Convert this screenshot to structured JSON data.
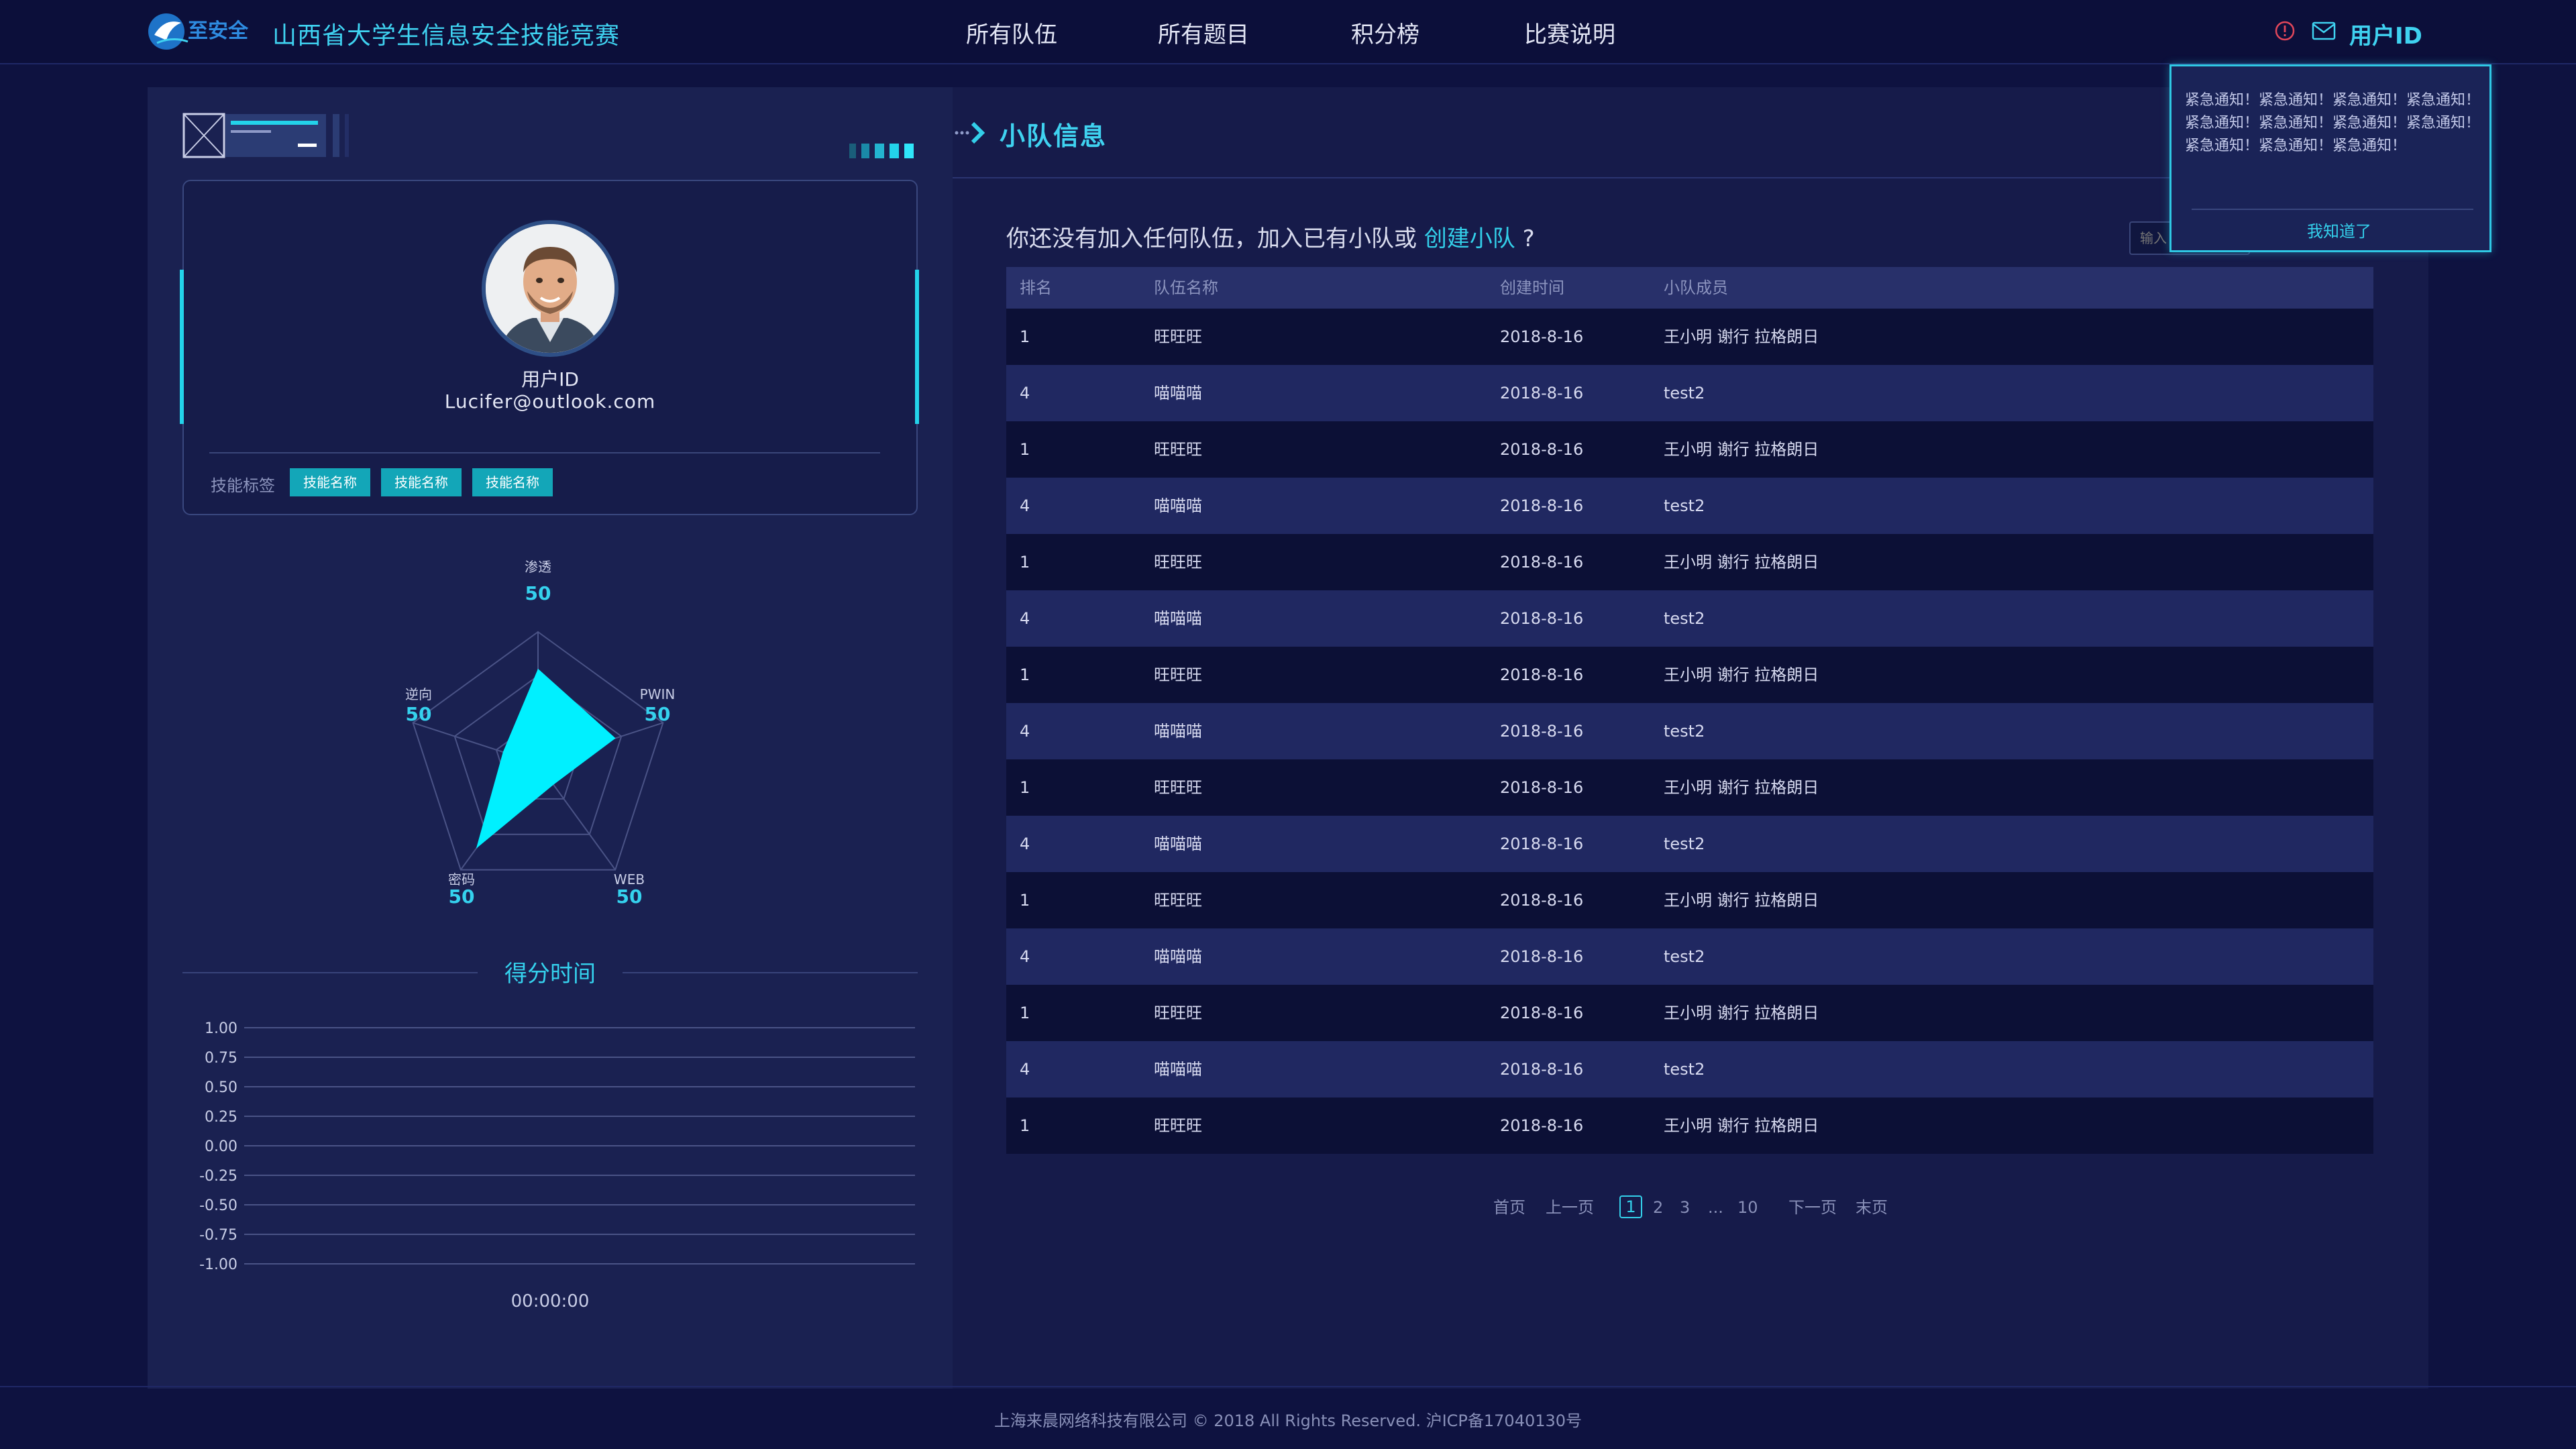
{
  "header": {
    "logo_text": "至安全",
    "site_title": "山西省大学生信息安全技能竞赛",
    "nav": [
      "所有队伍",
      "所有题目",
      "积分榜",
      "比赛说明"
    ],
    "user_label": "用户ID",
    "alert_icon": "alert-circle-icon",
    "mail_icon": "mail-icon"
  },
  "profile": {
    "user_id": "用户ID",
    "email": "Lucifer@outlook.com",
    "skill_label": "技能标签",
    "skills": [
      "技能名称",
      "技能名称",
      "技能名称"
    ]
  },
  "radar": {
    "axes": [
      {
        "name": "渗透",
        "value": "50"
      },
      {
        "name": "PWIN",
        "value": "50"
      },
      {
        "name": "WEB",
        "value": "50"
      },
      {
        "name": "密码",
        "value": "50"
      },
      {
        "name": "逆向",
        "value": "50"
      }
    ]
  },
  "score_time": {
    "title": "得分时间",
    "y_ticks": [
      "1.00",
      "0.75",
      "0.50",
      "0.25",
      "0.00",
      "-0.25",
      "-0.50",
      "-0.75",
      "-1.00"
    ],
    "x_label": "00:00:00"
  },
  "team": {
    "section_title": "小队信息",
    "prompt_prefix": "你还没有加入任何队伍，加入已有小队或",
    "prompt_link": "创建小队",
    "prompt_suffix": "?",
    "search_placeholder": "输入",
    "columns": [
      "排名",
      "队伍名称",
      "创建时间",
      "小队成员"
    ],
    "rows": [
      [
        "1",
        "旺旺旺",
        "2018-8-16",
        "王小明  谢行  拉格朗日"
      ],
      [
        "4",
        "喵喵喵",
        "2018-8-16",
        "test2"
      ],
      [
        "1",
        "旺旺旺",
        "2018-8-16",
        "王小明  谢行  拉格朗日"
      ],
      [
        "4",
        "喵喵喵",
        "2018-8-16",
        "test2"
      ],
      [
        "1",
        "旺旺旺",
        "2018-8-16",
        "王小明  谢行  拉格朗日"
      ],
      [
        "4",
        "喵喵喵",
        "2018-8-16",
        "test2"
      ],
      [
        "1",
        "旺旺旺",
        "2018-8-16",
        "王小明  谢行  拉格朗日"
      ],
      [
        "4",
        "喵喵喵",
        "2018-8-16",
        "test2"
      ],
      [
        "1",
        "旺旺旺",
        "2018-8-16",
        "王小明  谢行  拉格朗日"
      ],
      [
        "4",
        "喵喵喵",
        "2018-8-16",
        "test2"
      ],
      [
        "1",
        "旺旺旺",
        "2018-8-16",
        "王小明  谢行  拉格朗日"
      ],
      [
        "4",
        "喵喵喵",
        "2018-8-16",
        "test2"
      ],
      [
        "1",
        "旺旺旺",
        "2018-8-16",
        "王小明  谢行  拉格朗日"
      ],
      [
        "4",
        "喵喵喵",
        "2018-8-16",
        "test2"
      ],
      [
        "1",
        "旺旺旺",
        "2018-8-16",
        "王小明  谢行  拉格朗日"
      ]
    ]
  },
  "pager": {
    "first": "首页",
    "prev": "上一页",
    "pages": [
      "1",
      "2",
      "3",
      "...",
      "10"
    ],
    "current": "1",
    "next": "下一页",
    "last": "末页"
  },
  "notice": {
    "text": "紧急通知！紧急通知！紧急通知！紧急通知！紧急通知！紧急通知！紧急通知！紧急通知！紧急通知！紧急通知！紧急通知！",
    "button": "我知道了"
  },
  "footer": {
    "text": "上海来晨网络科技有限公司 © 2018 All Rights Reserved.  沪ICP备17040130号"
  },
  "colors": {
    "accent": "#33cfe9",
    "background": "#0e1240",
    "panel": "#1a2151",
    "radar_fill": "#00f0ff"
  }
}
